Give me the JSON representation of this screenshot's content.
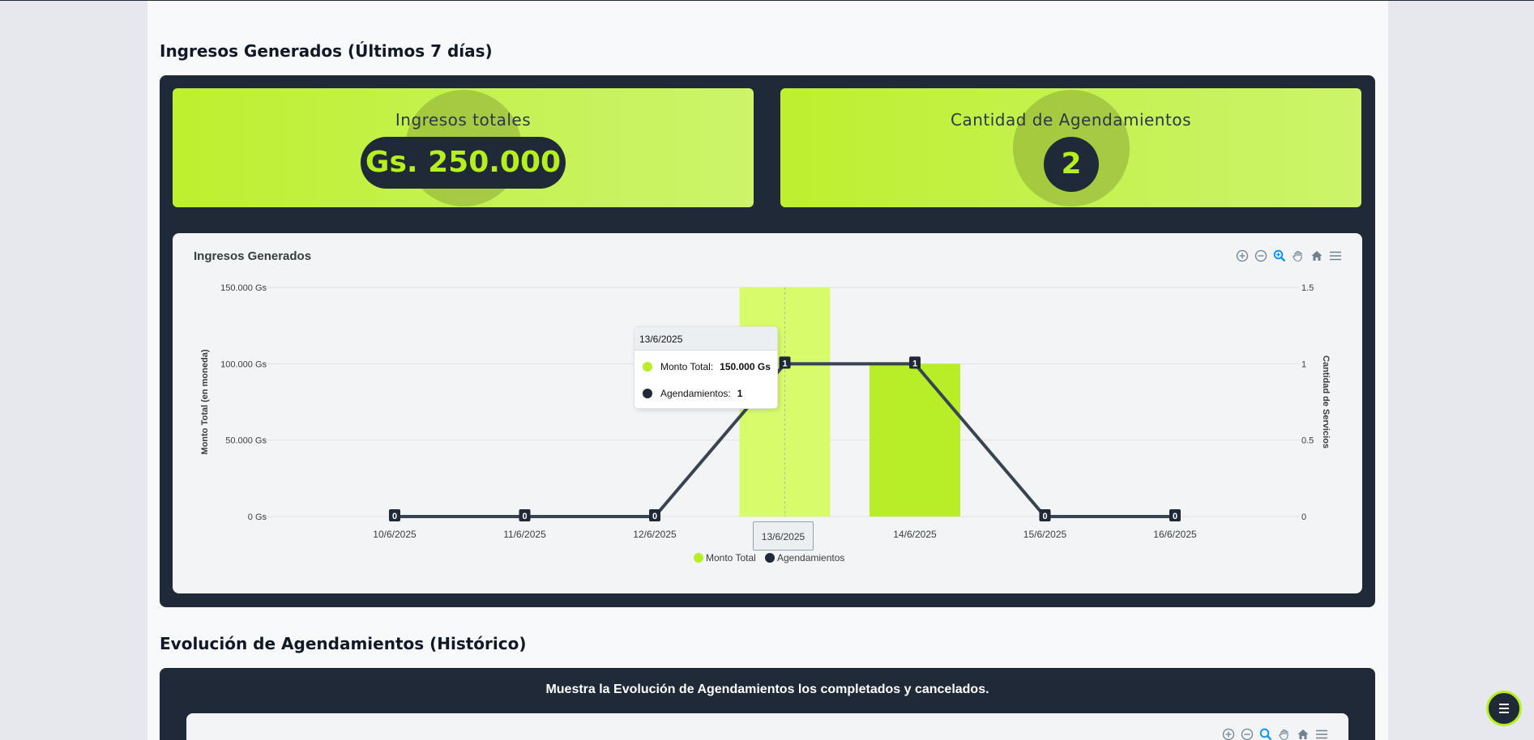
{
  "section1": {
    "title": "Ingresos Generados (Últimos 7 días)",
    "cards": {
      "income": {
        "title": "Ingresos totales",
        "value": "Gs. 250.000"
      },
      "count": {
        "title": "Cantidad de Agendamientos",
        "value": "2"
      }
    },
    "chart": {
      "title": "Ingresos Generados",
      "toolbar": [
        "zoom-in-icon",
        "zoom-out-icon",
        "zoom-select-icon",
        "pan-hand-icon",
        "home-reset-icon",
        "menu-icon"
      ],
      "tooltip": {
        "date": "13/6/2025",
        "rows": [
          {
            "label": "Monto Total:",
            "value": "150.000 Gs",
            "color": "#b8ee28"
          },
          {
            "label": "Agendamientos:",
            "value": "1",
            "color": "#1f2937"
          }
        ]
      },
      "x_highlight_label": "13/6/2025"
    }
  },
  "section2": {
    "title": "Evolución de Agendamientos (Histórico)",
    "caption": "Muestra la Evolución de Agendamientos los completados y cancelados."
  },
  "colors": {
    "accent": "#b5f01e",
    "dark": "#1f2937",
    "bar": "#b8ee28",
    "bar_hover": "#d8fb6c"
  },
  "chart_data": {
    "type": "bar",
    "categories": [
      "10/6/2025",
      "11/6/2025",
      "12/6/2025",
      "13/6/2025",
      "14/6/2025",
      "15/6/2025",
      "16/6/2025"
    ],
    "series": [
      {
        "name": "Monto Total",
        "type": "bar",
        "axis": "left",
        "values": [
          0,
          0,
          0,
          150000,
          100000,
          0,
          0
        ]
      },
      {
        "name": "Agendamientos",
        "type": "line",
        "axis": "right",
        "values": [
          0,
          0,
          0,
          1,
          1,
          0,
          0
        ]
      }
    ],
    "ylabel": "Monto Total (en moneda)",
    "y2label": "Cantidad de Servicios",
    "ylim": [
      0,
      150000
    ],
    "y2lim": [
      0,
      1.5
    ],
    "y_ticks": [
      "0 Gs",
      "50.000 Gs",
      "100.000 Gs",
      "150.000 Gs"
    ],
    "y2_ticks": [
      "0",
      "0.5",
      "1",
      "1.5"
    ],
    "line_labels": [
      "0",
      "0",
      "0",
      "1",
      "1",
      "0",
      "0"
    ],
    "legend": [
      "Monto Total",
      "Agendamientos"
    ],
    "legend_position": "bottom",
    "grid": true
  }
}
